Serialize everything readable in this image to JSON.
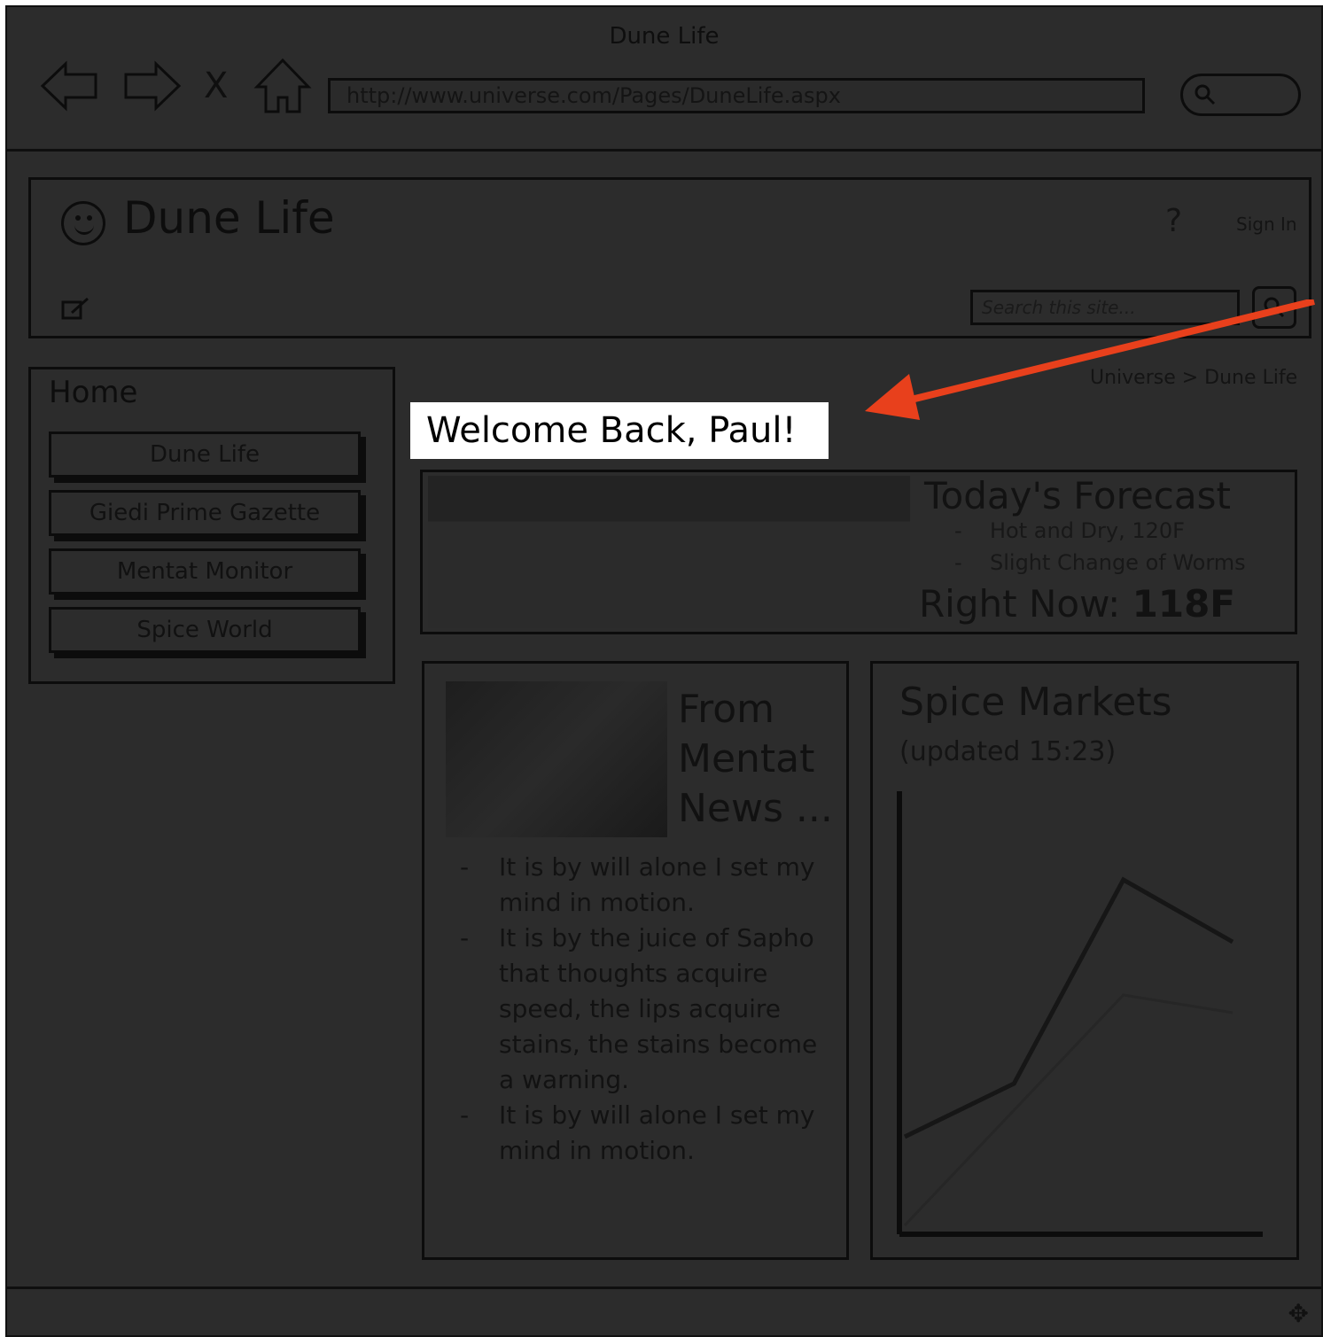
{
  "window": {
    "title": "Dune Life"
  },
  "browser": {
    "address": "http://www.universe.com/Pages/DuneLife.aspx",
    "back_icon": "left-arrow-icon",
    "forward_icon": "right-arrow-icon",
    "stop_label": "X",
    "home_icon": "home-icon",
    "search_icon": "search-icon"
  },
  "header": {
    "site_title": "Dune Life",
    "help_label": "?",
    "signin_label": "Sign In",
    "search_placeholder": "Search this site..."
  },
  "sidebar": {
    "home_label": "Home",
    "items": [
      {
        "label": "Dune Life"
      },
      {
        "label": "Giedi Prime Gazette"
      },
      {
        "label": "Mentat Monitor"
      },
      {
        "label": "Spice World"
      }
    ]
  },
  "breadcrumb": "Universe > Dune Life",
  "welcome": "Welcome Back, Paul!",
  "forecast": {
    "title": "Today's Forecast",
    "items": [
      "Hot and Dry, 120F",
      "Slight Change of Worms"
    ],
    "now_label": "Right Now:",
    "now_value": "118F"
  },
  "mentat": {
    "title_lines": [
      "From",
      "Mentat",
      "News ..."
    ],
    "items": [
      "It is by will alone I set my mind in motion.",
      "It is by the juice of Sapho that thoughts acquire speed, the lips acquire stains, the stains become a warning.",
      "It is by will alone I set my mind in motion."
    ]
  },
  "spice": {
    "title": "Spice Markets",
    "updated": "(updated 15:23)"
  },
  "chart_data": {
    "type": "line",
    "title": "",
    "xlabel": "",
    "ylabel": "",
    "series": [
      {
        "values": [
          2.2,
          3.4,
          8.0,
          6.6
        ]
      },
      {
        "values": [
          0.2,
          2.8,
          5.4,
          5.0
        ]
      }
    ],
    "ylim": [
      0,
      10
    ],
    "grid": false
  },
  "colors": {
    "overlay_dark": "#2c2c2c",
    "highlight_white": "#ffffff",
    "arrow_red": "#e8401c"
  }
}
